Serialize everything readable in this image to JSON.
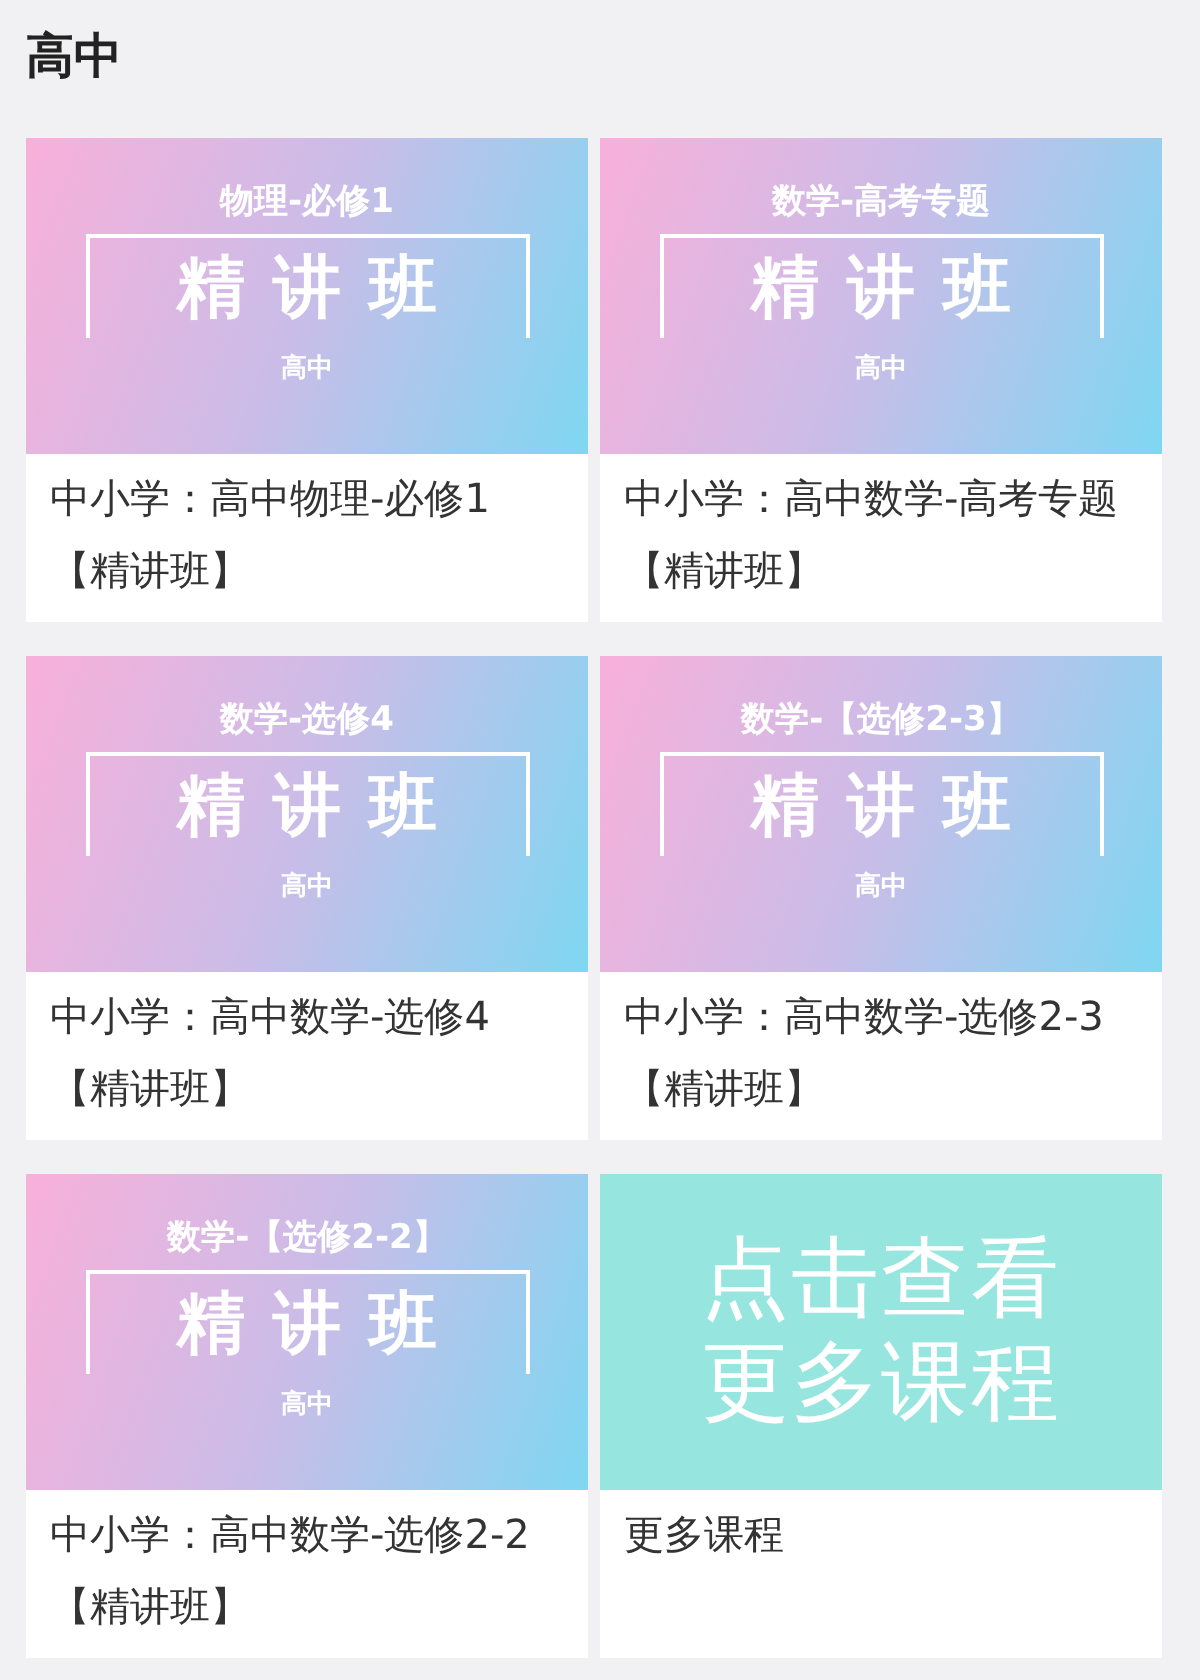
{
  "section_title": "高中",
  "courses": [
    {
      "kind": "banner",
      "banner_subtitle": "物理-必修1",
      "banner_title": "精讲班",
      "banner_tag": "高中",
      "caption": "中小学：高中物理-必修1【精讲班】"
    },
    {
      "kind": "banner",
      "banner_subtitle": "数学-高考专题",
      "banner_title": "精讲班",
      "banner_tag": "高中",
      "caption": "中小学：高中数学-高考专题【精讲班】"
    },
    {
      "kind": "banner",
      "banner_subtitle": "数学-选修4",
      "banner_title": "精讲班",
      "banner_tag": "高中",
      "caption": "中小学：高中数学-选修4【精讲班】"
    },
    {
      "kind": "banner",
      "banner_subtitle": "数学-【选修2-3】",
      "banner_title": "精讲班",
      "banner_tag": "高中",
      "caption": "中小学：高中数学-选修2-3【精讲班】"
    },
    {
      "kind": "banner",
      "banner_subtitle": "数学-【选修2-2】",
      "banner_title": "精讲班",
      "banner_tag": "高中",
      "caption": "中小学：高中数学-选修2-2【精讲班】"
    },
    {
      "kind": "more",
      "banner_lines": [
        "点击查看",
        "更多课程"
      ],
      "caption": "更多课程"
    }
  ]
}
